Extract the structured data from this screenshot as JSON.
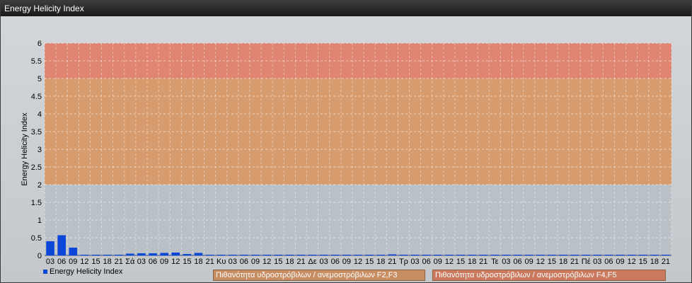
{
  "window": {
    "title": "Energy Helicity Index"
  },
  "legend": {
    "series_label": "Energy Helicity Index"
  },
  "bands": {
    "f2f3_label": "Πιθανότητα υδροστρόβιλων / ανεμοστρόβιλων F2,F3",
    "f4f5_label": "Πιθανότητα υδροστρόβιλων / ανεμοστρόβιλων F4,F5"
  },
  "colors": {
    "bar": "#0b46d8",
    "band_low": "#b9c0c6",
    "band_mid": "#d79c6e",
    "band_high": "#df8572",
    "grid": "#ffffff"
  },
  "chart_data": {
    "type": "bar",
    "ylabel": "Energy Helicity Index",
    "ylim": [
      0,
      6
    ],
    "yticks": [
      "0",
      "0.5",
      "1",
      "1.5",
      "2",
      "2.5",
      "3",
      "3.5",
      "4",
      "4.5",
      "5",
      "5.5",
      "6"
    ],
    "bands": [
      {
        "from": 0,
        "to": 2,
        "color": "#b9c0c6"
      },
      {
        "from": 2,
        "to": 5,
        "color": "#d79c6e"
      },
      {
        "from": 5,
        "to": 6,
        "color": "#df8572"
      }
    ],
    "categories": [
      "03",
      "06",
      "09",
      "12",
      "15",
      "18",
      "21",
      "Σά",
      "03",
      "06",
      "09",
      "12",
      "15",
      "18",
      "21",
      "Κυ",
      "03",
      "06",
      "09",
      "12",
      "15",
      "18",
      "21",
      "Δε",
      "03",
      "06",
      "09",
      "12",
      "15",
      "18",
      "21",
      "Τρ",
      "03",
      "06",
      "09",
      "12",
      "15",
      "18",
      "21",
      "Τε",
      "03",
      "06",
      "09",
      "12",
      "15",
      "18",
      "21",
      "Πέ",
      "03",
      "06",
      "09",
      "12",
      "15",
      "18",
      "21"
    ],
    "values": [
      0.4,
      0.57,
      0.22,
      0.02,
      0.02,
      0.02,
      0.02,
      0.05,
      0.06,
      0.06,
      0.07,
      0.08,
      0.04,
      0.07,
      0.02,
      0.02,
      0.02,
      0.02,
      0.02,
      0.02,
      0.02,
      0.02,
      0.02,
      0.02,
      0.02,
      0.02,
      0.02,
      0.02,
      0.02,
      0.02,
      0.03,
      0.02,
      0.02,
      0.02,
      0.02,
      0.02,
      0.02,
      0.02,
      0.02,
      0.02,
      0.02,
      0.02,
      0.02,
      0.02,
      0.02,
      0.02,
      0.02,
      0.02,
      0.02,
      0.02,
      0.02,
      0.02,
      0.02,
      0.02,
      0.02
    ]
  }
}
